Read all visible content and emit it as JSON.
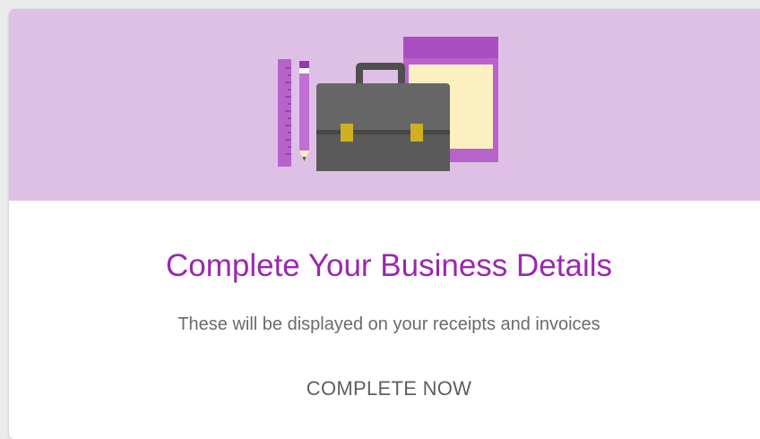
{
  "card": {
    "title": "Complete Your Business Details",
    "subtitle": "These will be displayed on your receipts and invoices",
    "action_label": "COMPLETE NOW"
  },
  "illustration": {
    "icons": [
      "ruler-icon",
      "pencil-icon",
      "briefcase-icon",
      "notebook-icon"
    ]
  },
  "colors": {
    "banner_background": "#dec0e6",
    "title": "#9c27b0",
    "accent_purple": "#a84ec1",
    "briefcase": "#666667",
    "paper": "#fdf0c0",
    "clasp": "#cfb020"
  }
}
